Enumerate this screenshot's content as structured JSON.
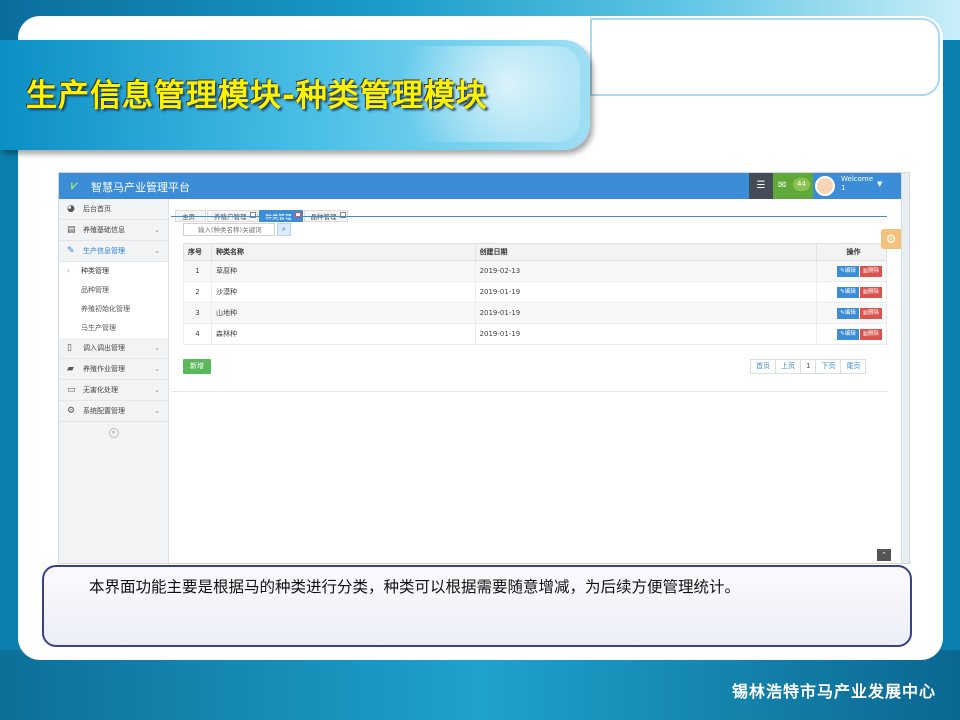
{
  "slide": {
    "title": "生产信息管理模块-种类管理模块",
    "description": "本界面功能主要是根据马的种类进行分类，种类可以根据需要随意增减，为后续方便管理统计。",
    "footer_org": "锡林浩特市马产业发展中心"
  },
  "app": {
    "title": "智慧马产业管理平台",
    "header": {
      "mail_count": "44",
      "welcome_label": "Welcome",
      "user_name": "1"
    },
    "sidebar": {
      "items": [
        {
          "label": "后台首页",
          "icon": "dashboard-icon"
        },
        {
          "label": "养殖基础信息",
          "icon": "table-icon"
        },
        {
          "label": "生产信息管理",
          "icon": "edit-icon"
        },
        {
          "label": "调入调出管理",
          "icon": "file-icon"
        },
        {
          "label": "养殖作业管理",
          "icon": "folder-open-icon"
        },
        {
          "label": "无害化处理",
          "icon": "desktop-icon"
        },
        {
          "label": "系统配置管理",
          "icon": "cogs-icon"
        }
      ],
      "subitems": [
        "种类管理",
        "品种管理",
        "养殖初始化管理",
        "马生产管理"
      ]
    },
    "tabs": [
      "主页",
      "养殖户管理",
      "种类管理",
      "品种管理"
    ],
    "search": {
      "placeholder": "输入(种类名称)关键词"
    },
    "table": {
      "headers": [
        "序号",
        "种类名称",
        "创建日期",
        "操作"
      ],
      "rows": [
        {
          "no": "1",
          "name": "草原种",
          "date": "2019-02-13"
        },
        {
          "no": "2",
          "name": "沙漠种",
          "date": "2019-01-19"
        },
        {
          "no": "3",
          "name": "山地种",
          "date": "2019-01-19"
        },
        {
          "no": "4",
          "name": "森林种",
          "date": "2019-01-19"
        }
      ],
      "edit_label": "编辑",
      "delete_label": "删除"
    },
    "add_label": "新增",
    "pager": {
      "first": "首页",
      "prev": "上页",
      "current": "1",
      "next": "下页",
      "last": "尾页"
    }
  }
}
